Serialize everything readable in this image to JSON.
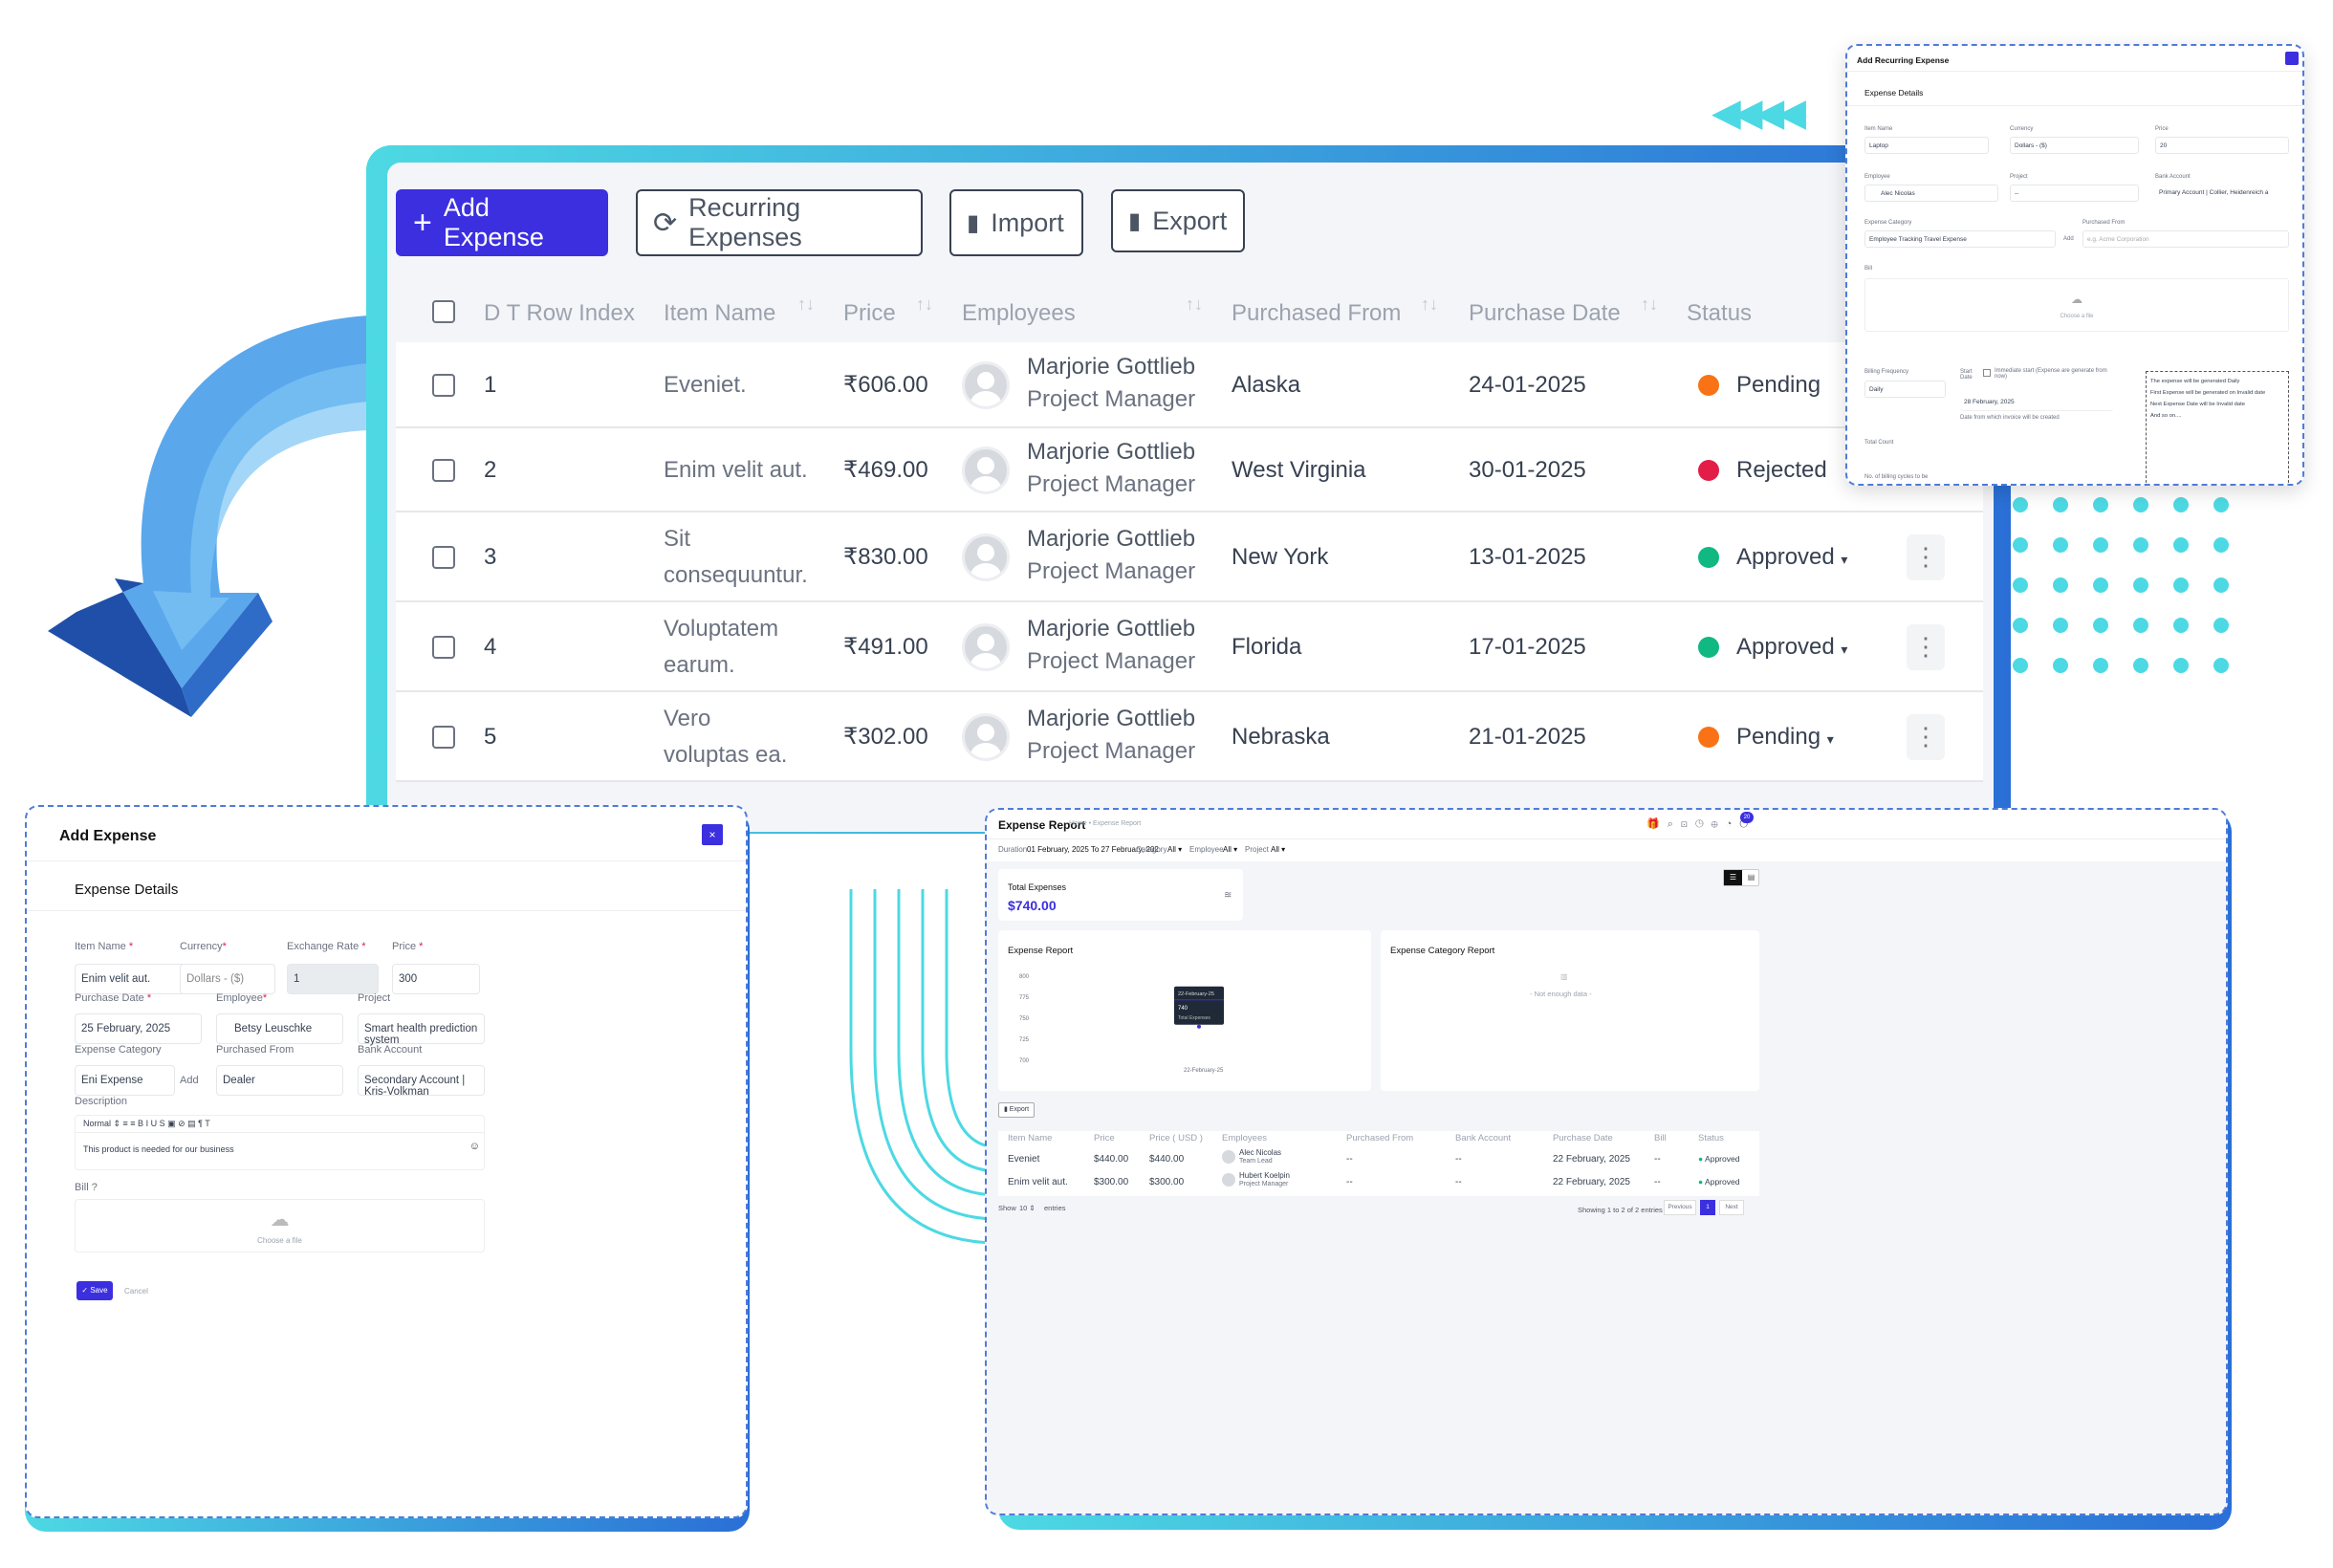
{
  "toolbar": {
    "add_label": "Add Expense",
    "recurring_label": "Recurring Expenses",
    "import_label": "Import",
    "export_label": "Export"
  },
  "table": {
    "headers": [
      "D T Row Index",
      "Item Name",
      "Price",
      "Employees",
      "Purchased From",
      "Purchase Date",
      "Status"
    ],
    "rows": [
      {
        "index": "1",
        "item": "Eveniet.",
        "item2": "",
        "price": "₹606.00",
        "employee": "Marjorie Gottlieb",
        "role": "Project Manager",
        "from": "Alaska",
        "date": "24-01-2025",
        "status": "Pending",
        "color": "#f97316"
      },
      {
        "index": "2",
        "item": "Enim velit aut.",
        "item2": "",
        "price": "₹469.00",
        "employee": "Marjorie Gottlieb",
        "role": "Project Manager",
        "from": "West Virginia",
        "date": "30-01-2025",
        "status": "Rejected",
        "color": "#e11d48"
      },
      {
        "index": "3",
        "item": "Sit",
        "item2": "consequuntur.",
        "price": "₹830.00",
        "employee": "Marjorie Gottlieb",
        "role": "Project Manager",
        "from": "New York",
        "date": "13-01-2025",
        "status": "Approved",
        "color": "#10b981"
      },
      {
        "index": "4",
        "item": "Voluptatem",
        "item2": "earum.",
        "price": "₹491.00",
        "employee": "Marjorie Gottlieb",
        "role": "Project Manager",
        "from": "Florida",
        "date": "17-01-2025",
        "status": "Approved",
        "color": "#10b981"
      },
      {
        "index": "5",
        "item": "Vero",
        "item2": "voluptas ea.",
        "price": "₹302.00",
        "employee": "Marjorie Gottlieb",
        "role": "Project Manager",
        "from": "Nebraska",
        "date": "21-01-2025",
        "status": "Pending",
        "color": "#f97316"
      }
    ]
  },
  "recurring": {
    "title": "Add Recurring Expense",
    "section": "Expense Details",
    "item_name_label": "Item Name",
    "item_name": "Laptop",
    "currency_label": "Currency",
    "currency": "Dollars - ($)",
    "price_label": "Price",
    "price": "20",
    "employee_label": "Employee",
    "employee": "Alec Nicolas",
    "project_label": "Project",
    "project": "--",
    "bank_label": "Bank Account",
    "bank": "Primary Account | Collier, Heidenreich a",
    "category_label": "Expense Category",
    "category": "Employee Tracking Travel Expense",
    "add": "Add",
    "purchased_label": "Purchased From",
    "purchased_ph": "e.g. Acme Corporation",
    "bill_label": "Bill",
    "choose": "Choose a file",
    "freq_label": "Billing Frequency",
    "freq": "Daily",
    "start_label": "Start Date",
    "start": "28 February, 2025",
    "immediate": "Immediate start (Expense are generate from now)",
    "date_hint": "Date from which invoice will be created",
    "count_label": "Total Count",
    "count_hint": "No. of billing cycles to be",
    "info": [
      "The expense will be generated Daily",
      "First Expense will be generated on Invalid date",
      "Next Expense Date will be Invalid date",
      "And so on...."
    ]
  },
  "add_modal": {
    "title": "Add Expense",
    "section": "Expense Details",
    "item_name_label": "Item Name",
    "item_name": "Enim velit aut.",
    "currency_label": "Currency",
    "currency": "Dollars - ($)",
    "rate_label": "Exchange Rate",
    "rate": "1",
    "price_label": "Price",
    "price": "300",
    "date_label": "Purchase Date",
    "date": "25 February, 2025",
    "employee_label": "Employee",
    "employee": "Betsy Leuschke",
    "project_label": "Project",
    "project": "Smart health prediction system",
    "category_label": "Expense Category",
    "category": "Eni Expense",
    "add": "Add",
    "purchased_label": "Purchased From",
    "purchased": "Dealer",
    "bank_label": "Bank Account",
    "bank": "Secondary Account | Kris-Volkman",
    "desc_label": "Description",
    "editor_style": "Normal",
    "desc": "This product is needed for our business",
    "bill_label": "Bill",
    "choose": "Choose a file",
    "save": "Save",
    "cancel": "Cancel"
  },
  "report": {
    "title": "Expense Report",
    "crumb": "Home • Expense Report",
    "duration_label": "Duration",
    "duration": "01 February, 2025 To 27 February, 202",
    "category_label": "Category",
    "employee_label": "Employee",
    "project_label": "Project",
    "all": "All",
    "total_label": "Total Expenses",
    "total": "$740.00",
    "chart_title": "Expense Report",
    "cat_title": "Expense Category Report",
    "no_data": "- Not enough data -",
    "tooltip_date": "22-February-25",
    "tooltip_val": "740",
    "tooltip_label": "Total Expenses",
    "export": "Export",
    "badge": "20",
    "headers": [
      "Item Name",
      "Price",
      "Price ( USD )",
      "Employees",
      "Purchased From",
      "Bank Account",
      "Purchase Date",
      "Bill",
      "Status"
    ],
    "rows": [
      {
        "item": "Eveniet",
        "price": "$440.00",
        "usd": "$440.00",
        "emp": "Alec Nicolas",
        "role": "Team Lead",
        "from": "--",
        "bank": "--",
        "date": "22 February, 2025",
        "bill": "--",
        "status": "Approved"
      },
      {
        "item": "Enim velit aut.",
        "price": "$300.00",
        "usd": "$300.00",
        "emp": "Hubert Koelpin",
        "role": "Project Manager",
        "from": "--",
        "bank": "--",
        "date": "22 February, 2025",
        "bill": "--",
        "status": "Approved"
      }
    ],
    "show": "Show",
    "show_n": "10",
    "entries": "entries",
    "showing": "Showing 1 to 2 of 2 entries",
    "prev": "Previous",
    "page": "1",
    "next": "Next"
  },
  "chart_data": {
    "type": "line",
    "x": [
      "22-February-25"
    ],
    "series": [
      {
        "name": "Total Expenses",
        "values": [
          740
        ]
      }
    ],
    "yticks": [
      700,
      725,
      750,
      775,
      800
    ],
    "ylim": [
      700,
      800
    ],
    "title": "Expense Report"
  }
}
